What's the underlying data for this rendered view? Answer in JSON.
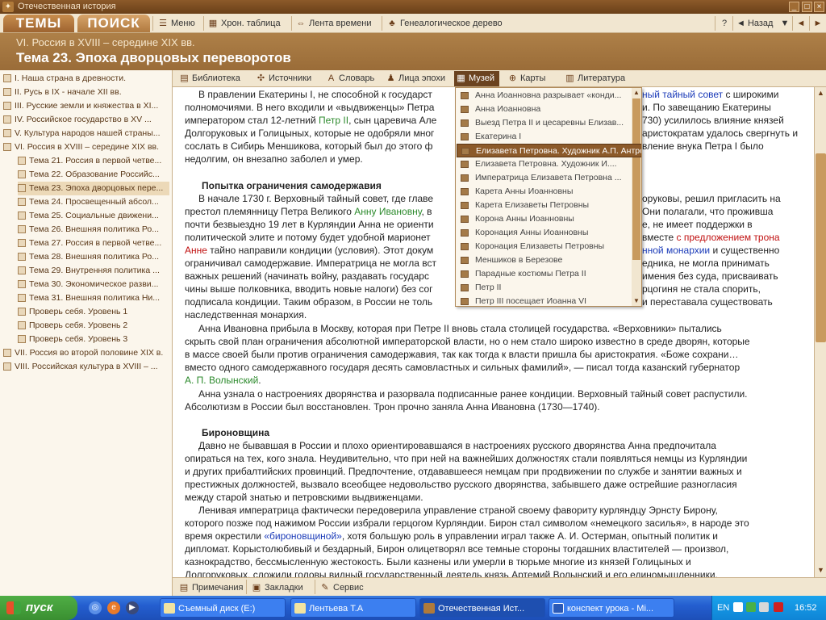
{
  "window": {
    "title": "Отечественная история",
    "logo_text": "✦"
  },
  "toolbar": {
    "tab_topics": "ТЕМЫ",
    "tab_search": "ПОИСК",
    "menu": "Меню",
    "chron_table": "Хрон. таблица",
    "timeline": "Лента времени",
    "genealogy": "Генеалогическое дерево",
    "help": "?",
    "back": "Назад"
  },
  "header": {
    "section": "VI. Россия в XVIII – середине XIX вв.",
    "topic": "Тема 23. Эпоха дворцовых переворотов"
  },
  "sidebar": {
    "items": [
      {
        "label": "I. Наша страна в древности.",
        "level": 0
      },
      {
        "label": "II. Русь в IX - начале XII вв.",
        "level": 0
      },
      {
        "label": "III. Русские земли и княжества в XI...",
        "level": 0
      },
      {
        "label": "IV. Российское государство в XV ...",
        "level": 0
      },
      {
        "label": "V. Культура народов нашей страны...",
        "level": 0
      },
      {
        "label": "VI. Россия в XVIII – середине XIX вв.",
        "level": 0
      },
      {
        "label": "Тема 21. Россия в первой четве...",
        "level": 1
      },
      {
        "label": "Тема 22. Образование Российс...",
        "level": 1
      },
      {
        "label": "Тема 23. Эпоха дворцовых пере...",
        "level": 1
      },
      {
        "label": "Тема 24. Просвещенный абсол...",
        "level": 1
      },
      {
        "label": "Тема 25. Социальные движени...",
        "level": 1
      },
      {
        "label": "Тема 26. Внешняя политика Ро...",
        "level": 1
      },
      {
        "label": "Тема 27. Россия в первой четве...",
        "level": 1
      },
      {
        "label": "Тема 28. Внешняя политика Ро...",
        "level": 1
      },
      {
        "label": "Тема 29. Внутренняя политика ...",
        "level": 1
      },
      {
        "label": "Тема 30. Экономическое разви...",
        "level": 1
      },
      {
        "label": "Тема 31. Внешняя политика Ни...",
        "level": 1
      },
      {
        "label": "Проверь себя. Уровень 1",
        "level": 1
      },
      {
        "label": "Проверь себя. Уровень 2",
        "level": 1
      },
      {
        "label": "Проверь себя. Уровень 3",
        "level": 1
      },
      {
        "label": "VII. Россия во второй половине XIX в.",
        "level": 0
      },
      {
        "label": "VIII. Российская культура в XVIII – ...",
        "level": 0
      }
    ]
  },
  "section_tabs": {
    "library": "Библиотека",
    "sources": "Источники",
    "dictionary": "Словарь",
    "persons": "Лица эпохи",
    "museum": "Музей",
    "maps": "Карты",
    "literature": "Литература"
  },
  "museum_menu": {
    "items": [
      "Анна Иоанновна разрывает «конди...",
      "Анна Иоанновна",
      "Выезд Петра II и цесаревны Елизав...",
      "Екатерина I",
      "Елизавета Петровна. Художник А.П. Антропов.",
      "Елизавета Петровна. Художник И....",
      "Императрица Елизавета Петровна ...",
      "Карета Анны Иоанновны",
      "Карета Елизаветы Петровны",
      "Корона Анны Иоанновны",
      "Коронация Анны Иоанновны",
      "Коронация Елизаветы Петровны",
      "Меншиков в Березове",
      "Парадные костюмы Петра II",
      "Петр II",
      "Петр III посещает Иоанна VI"
    ]
  },
  "article": {
    "p1": {
      "l1a": "В правлении Екатерины I, не способной к государст",
      "l1b": "ный тайный совет",
      "l1c": " с широкими",
      "l2a": "полномочиями. В него входили и «выдвиженцы» Петра",
      "l2b": "и. По завещанию Екатерины",
      "l3a": "императором стал 12-летний ",
      "l3b": "Петр II",
      "l3c": ", сын царевича Але",
      "l3d": "730) усилилось влияние князей",
      "l4a": "Долгоруковых и Голицыных, которые не одобряли мног",
      "l4b": "аристократам удалось свергнуть и",
      "l5a": "сослать в Сибирь Меншикова, который был до этого ф",
      "l5b": "вление внука Петра I было",
      "l6": "недолгим, он внезапно заболел и умер."
    },
    "h1": "Попытка ограничения самодержавия",
    "p2": {
      "l1a": "В начале 1730 г. Верховный тайный совет, где главе",
      "l1b": "оруковы, решил пригласить на",
      "l2a": "престол племянницу Петра Великого ",
      "l2b": "Анну Ивановну",
      "l2c": ", в",
      "l2d": "Они полагали, что проживша",
      "l3a": "почти безвыездно 19 лет в Курляндии Анна не ориенти",
      "l3b": "е, не имеет поддержки в",
      "l4a": "политической элите и потому будет удобной марионет",
      "l4b": "вместе ",
      "l4c": "с предложением трона",
      "l5a": "Анне",
      "l5b": " тайно направили кондиции (условия). Этот докум",
      "l5c": "нной монархии",
      "l5d": " и существенно",
      "l6a": "ограничивал самодержавие. Императрица не могла вст",
      "l6b": "едника, не могла принимать",
      "l7a": "важных решений (начинать войну, раздавать государс",
      "l7b": "имения без суда, присваивать",
      "l8a": "чины выше полковника, вводить новые налоги) без сог",
      "l8b": "рцогиня не стала спорить,",
      "l9a": "подписала кондиции. Таким образом, в России не толь",
      "l9b": "и переставала существовать",
      "l10": "наследственная монархия."
    },
    "p3": {
      "l1": "Анна Ивановна прибыла в Москву, которая при Петре II вновь стала столицей государства. «Верховники» пытались",
      "l2": "скрыть свой план ограничения абсолютной императорской власти, но о нем стало широко известно в среде дворян, которые",
      "l3": "в массе своей были против ограничения самодержавия, так как тогда к власти пришла бы аристократия. «Боже сохрани…",
      "l4": "вместо одного самодержавного государя десять самовластных и сильных фамилий», — писал тогда казанский губернатор",
      "l5": "А. П. Волынский",
      "l5b": "."
    },
    "p4": {
      "l1": "Анна узнала о настроениях дворянства и разорвала подписанные ранее кондиции. Верховный тайный совет распустили.",
      "l2": "Абсолютизм в России был восстановлен. Трон прочно заняла Анна Ивановна (1730—1740)."
    },
    "h2": "Бироновщина",
    "p5": {
      "l1": "Давно не бывавшая в России и плохо ориентировавшаяся в настроениях русского дворянства Анна предпочитала",
      "l2": "опираться на тех, кого знала. Неудивительно, что при ней на важнейших должностях стали появляться немцы из Курляндии",
      "l3": "и других прибалтийских провинций. Предпочтение, отдававшееся немцам при продвижении по службе и занятии важных и",
      "l4": "престижных должностей, вызвало всеобщее недовольство русского дворянства, забывшего даже острейшие разногласия",
      "l5": "между старой знатью и петровскими выдвиженцами."
    },
    "p6": {
      "l1": "Ленивая императрица фактически передоверила управление страной своему фавориту курляндцу Эрнсту Бирону,",
      "l2": "которого позже под нажимом России избрали герцогом Курляндии. Бирон стал символом «немецкого засилья», в народе это",
      "l3a": "время окрестили ",
      "l3b": "«бироновщиной»",
      "l3c": ", хотя большую роль в управлении играл также А. И. Остерман, опытный политик и",
      "l4": "дипломат. Корыстолюбивый и бездарный, Бирон олицетворял все темные стороны тогдашних властителей — произвол,",
      "l5": "казнокрадство, бессмысленную жестокость. Были казнены или умерли в тюрьме многие из князей Голицыных и",
      "l6": "Долгоруковых, сложили головы видный государственный деятель князь Артемий Волынский и его единомышленники."
    },
    "colors": {
      "green": "#2c8a2c",
      "red": "#c01010",
      "blue": "#1a3ab8"
    }
  },
  "bottom_tabs": {
    "notes": "Примечания",
    "bookmarks": "Закладки",
    "service": "Сервис"
  },
  "taskbar": {
    "start": "пуск",
    "tasks": [
      "Съемный диск (E:)",
      "Лентьева Т.А",
      "Отечественная Ист...",
      "конспект урока - Mi..."
    ],
    "lang": "EN",
    "time": "16:52"
  }
}
